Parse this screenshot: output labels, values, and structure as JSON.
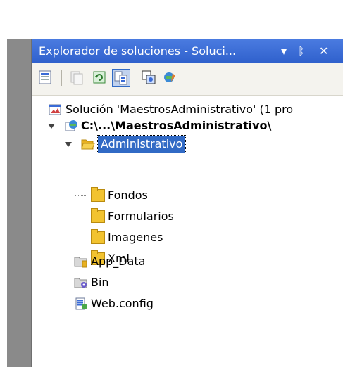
{
  "panel": {
    "title": "Explorador de soluciones - Soluci...",
    "pin_glyph": "▾",
    "dock_glyph": "ᛒ",
    "close_glyph": "✕"
  },
  "toolbar": {
    "buttons": [
      {
        "name": "properties-icon"
      },
      {
        "name": "show-all-files-icon"
      },
      {
        "name": "refresh-icon"
      },
      {
        "name": "nest-related-files-icon"
      },
      {
        "name": "copy-website-icon"
      },
      {
        "name": "asp-net-config-icon"
      }
    ]
  },
  "tree": {
    "solution": "Solución 'MaestrosAdministrativo' (1 pro",
    "project": "C:\\...\\MaestrosAdministrativo\\",
    "administrativo": "Administrativo",
    "fondos": "Fondos",
    "formularios": "Formularios",
    "imagenes": "Imagenes",
    "xml": "Xml",
    "app_data": "App_Data",
    "bin": "Bin",
    "web_config": "Web.config"
  },
  "colors": {
    "title_bar": "#3a6bd6",
    "selection": "#316ac5",
    "folder": "#f2c330"
  }
}
